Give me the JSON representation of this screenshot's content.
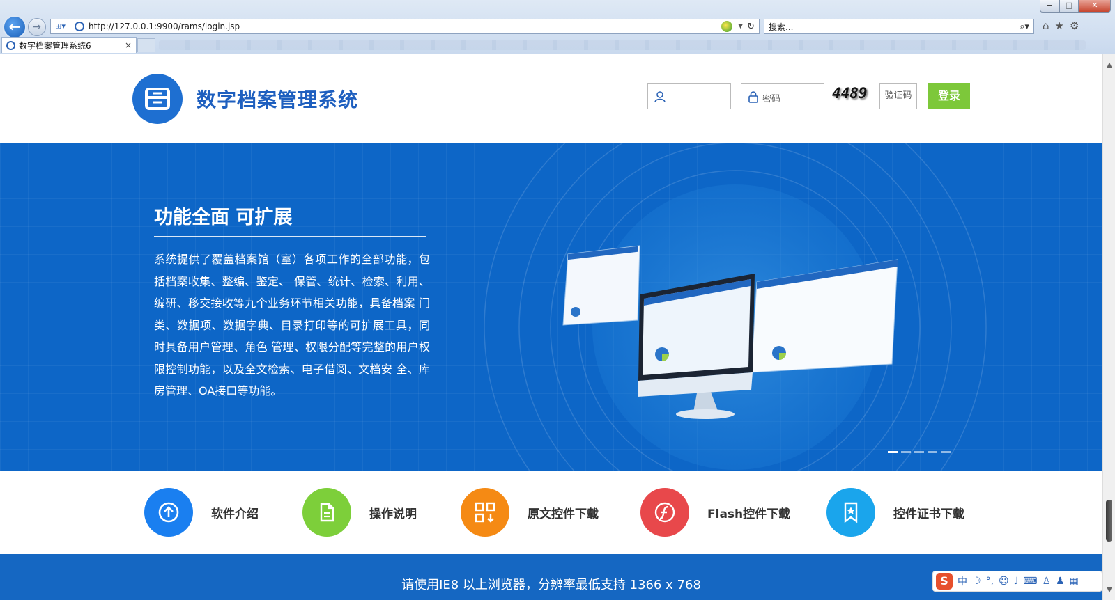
{
  "browser": {
    "url": "http://127.0.0.1:9900/rams/login.jsp",
    "search_placeholder": "搜索...",
    "tab_title": "数字档案管理系统6",
    "tab_close": "×",
    "win_min": "−",
    "win_max": "□",
    "win_close": "✕"
  },
  "header": {
    "title": "数字档案管理系统",
    "password_placeholder": "密码",
    "captcha_value": "4489",
    "captcha_placeholder": "验证码",
    "login_label": "登录"
  },
  "banner": {
    "title": "功能全面 可扩展",
    "description": "系统提供了覆盖档案馆（室）各项工作的全部功能，包括档案收集、整编、鉴定、 保管、统计、检索、利用、编研、移交接收等九个业务环节相关功能，具备档案 门类、数据项、数据字典、目录打印等的可扩展工具，同时具备用户管理、角色 管理、权限分配等完整的用户权限控制功能，以及全文检索、电子借阅、文档安 全、库房管理、OA接口等功能。",
    "slide_count": 5,
    "active_slide": 1
  },
  "features": [
    {
      "label": "软件介绍",
      "color": "#1a7ff0",
      "icon": "upload-circle-icon"
    },
    {
      "label": "操作说明",
      "color": "#7dcf3a",
      "icon": "document-icon"
    },
    {
      "label": "原文控件下载",
      "color": "#f58a14",
      "icon": "grid-download-icon"
    },
    {
      "label": "Flash控件下载",
      "color": "#e8484b",
      "icon": "flash-icon"
    },
    {
      "label": "控件证书下载",
      "color": "#1aa5ec",
      "icon": "certificate-icon"
    }
  ],
  "footer": {
    "notice": "请使用IE8 以上浏览器，分辨率最低支持 1366 x 768"
  },
  "ime": {
    "logo": "S",
    "mode": "中"
  }
}
